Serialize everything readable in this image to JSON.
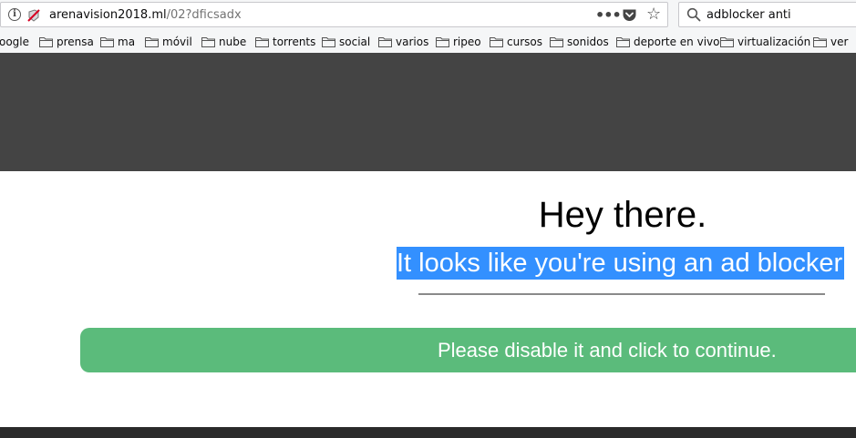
{
  "browser": {
    "url_host": "arenavision2018.ml",
    "url_path": "/02?dficsadx",
    "page_actions_label": "•••",
    "search_query": "adblocker anti",
    "icons": {
      "info": "info-icon",
      "tracking": "blocked-content-icon",
      "page_actions": "ellipsis-icon",
      "pocket": "pocket-icon",
      "bookmark": "star-icon",
      "search": "search-icon",
      "folder": "folder-icon"
    }
  },
  "bookmarks": [
    {
      "label": "oogle",
      "folder": false
    },
    {
      "label": "prensa",
      "folder": true
    },
    {
      "label": "ma",
      "folder": true
    },
    {
      "label": "móvil",
      "folder": true
    },
    {
      "label": "nube",
      "folder": true
    },
    {
      "label": "torrents",
      "folder": true
    },
    {
      "label": "social",
      "folder": true
    },
    {
      "label": "varios",
      "folder": true
    },
    {
      "label": "ripeo",
      "folder": true
    },
    {
      "label": "cursos",
      "folder": true
    },
    {
      "label": "sonidos",
      "folder": true
    },
    {
      "label": "deporte en vivo",
      "folder": true
    },
    {
      "label": "virtualización",
      "folder": true
    },
    {
      "label": "ver",
      "folder": true
    }
  ],
  "page": {
    "headline": "Hey there.",
    "subhead": "It looks like you're using an ad blocker",
    "button_label": "Please disable it and click to continue."
  },
  "colors": {
    "dark_band": "#444444",
    "selection": "#3390ff",
    "button": "#5bbb7b",
    "footer": "#2b2b2b"
  }
}
